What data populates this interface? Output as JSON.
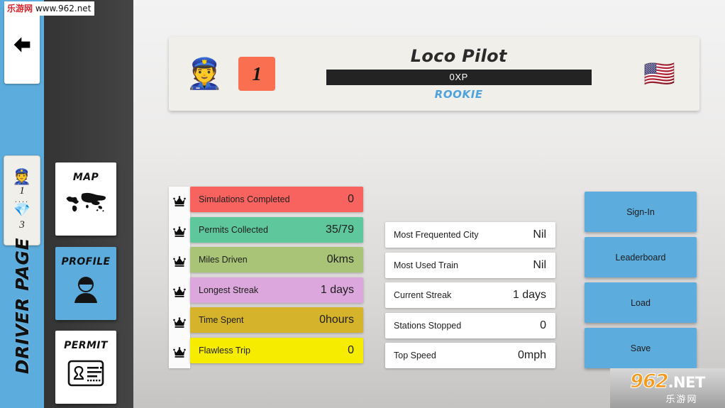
{
  "watermarks": {
    "top": {
      "cn": "乐游网",
      "url": " www.962.net"
    },
    "logo": {
      "num": "962",
      "net": ".NET",
      "sub": "乐游网"
    }
  },
  "rail": {
    "back_icon": "back-arrow-icon",
    "title": "DRIVER PAGE",
    "badge": {
      "avatar_icon": "👮",
      "level": "1",
      "dots": "....",
      "gem_icon": "💎",
      "gems": "3"
    }
  },
  "tabs": [
    {
      "label": "MAP",
      "icon": "world-map-icon",
      "active": false
    },
    {
      "label": "PROFILE",
      "icon": "person-icon",
      "active": true
    },
    {
      "label": "PERMIT",
      "icon": "id-card-icon",
      "active": false
    }
  ],
  "header": {
    "avatar_icon": "👮",
    "level": "1",
    "title": "Loco Pilot",
    "xp": "0XP",
    "rank": "ROOKIE",
    "flag_icon": "🇺🇸"
  },
  "stats": {
    "crown_icon": "crown-icon",
    "rows": [
      {
        "label": "Simulations Completed",
        "value": "0",
        "color": "#f9635f"
      },
      {
        "label": "Permits Collected",
        "value": "35/79",
        "color": "#5fc79c"
      },
      {
        "label": "Miles Driven",
        "value": "0kms",
        "color": "#a9c476"
      },
      {
        "label": "Longest Streak",
        "value": "1 days",
        "color": "#dba7dc"
      },
      {
        "label": "Time Spent",
        "value": "0hours",
        "color": "#d5b32b"
      },
      {
        "label": "Flawless Trip",
        "value": "0",
        "color": "#f6ec00"
      }
    ]
  },
  "info": {
    "rows": [
      {
        "label": "Most Frequented City",
        "value": "Nil"
      },
      {
        "label": "Most Used Train",
        "value": "Nil"
      },
      {
        "label": "Current Streak",
        "value": "1 days"
      },
      {
        "label": "Stations Stopped",
        "value": "0"
      },
      {
        "label": "Top Speed",
        "value": "0mph"
      }
    ]
  },
  "actions": [
    {
      "label": "Sign-In"
    },
    {
      "label": "Leaderboard"
    },
    {
      "label": "Load"
    },
    {
      "label": "Save"
    }
  ],
  "colors": {
    "accent_blue": "#5cadde",
    "rail_dark": "#3d3d3d",
    "level_chip": "#f96f4f",
    "xp_bar": "#232323",
    "rank_blue": "#4fa3dd"
  }
}
